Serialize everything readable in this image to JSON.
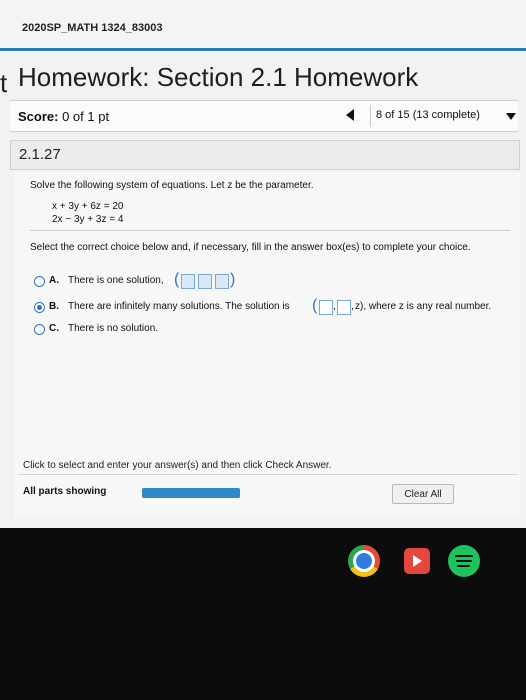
{
  "header": {
    "course": "2020SP_MATH 1324_83003",
    "sidebar_letter": "t",
    "title": "Homework: Section 2.1 Homework"
  },
  "score": {
    "label": "Score:",
    "value": "0 of 1 pt"
  },
  "navigation": {
    "progress_text": "8 of 15 (13 complete)"
  },
  "question": {
    "number": "2.1.27",
    "instruction": "Solve the following system of equations. Let z be the parameter.",
    "equations": [
      "x + 3y + 6z = 20",
      "2x − 3y + 3z = 4"
    ],
    "select_instruction": "Select the correct choice below and, if necessary, fill in the answer box(es) to complete your choice.",
    "choices": [
      {
        "letter": "A.",
        "text": "There is one solution,",
        "selected": false
      },
      {
        "letter": "B.",
        "text": "There are infinitely many solutions. The solution is",
        "suffix": "z), where z is any real number.",
        "selected": true
      },
      {
        "letter": "C.",
        "text": "There is no solution.",
        "selected": false
      }
    ]
  },
  "footer": {
    "help_text": "Click to select and enter your answer(s) and then click Check Answer.",
    "parts_label": "All parts showing",
    "progress_fraction": 1.0,
    "clear_label": "Clear All"
  },
  "colors": {
    "accent": "#2d72c8",
    "header_rule": "#2c7ab0",
    "progress_fill": "#2f88c7"
  },
  "taskbar_icons": [
    "chrome-icon",
    "play-store-icon",
    "spotify-icon"
  ]
}
